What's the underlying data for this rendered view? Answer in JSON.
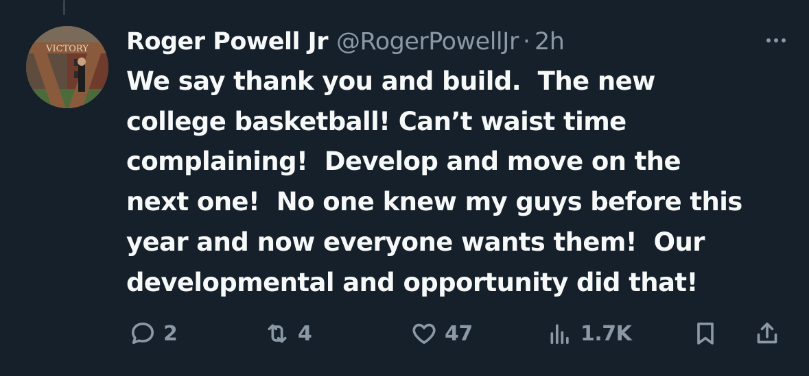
{
  "tweet": {
    "display_name": "Roger Powell Jr",
    "handle": "@RogerPowellJr",
    "separator": "·",
    "time": "2h",
    "text": "We say thank you and build.  The new\ncollege basketball! Can’t waist time\ncomplaining!  Develop and move on the\nnext one!  No one knew my guys before this\nyear and now everyone wants them!  Our\ndevelopmental and opportunity did that!",
    "avatar_sign_text": "VICTORY"
  },
  "actions": {
    "replies": "2",
    "reposts": "4",
    "likes": "47",
    "views": "1.7K"
  },
  "icons": {
    "more": "more-horizontal-icon",
    "reply": "reply-bubble-icon",
    "repost": "repost-arrows-icon",
    "like": "heart-icon",
    "views": "analytics-bars-icon",
    "bookmark": "bookmark-icon",
    "share": "share-upload-icon"
  },
  "colors": {
    "background": "#15202b",
    "primary_text": "#f7f9f9",
    "secondary_text": "#8b98a5"
  }
}
